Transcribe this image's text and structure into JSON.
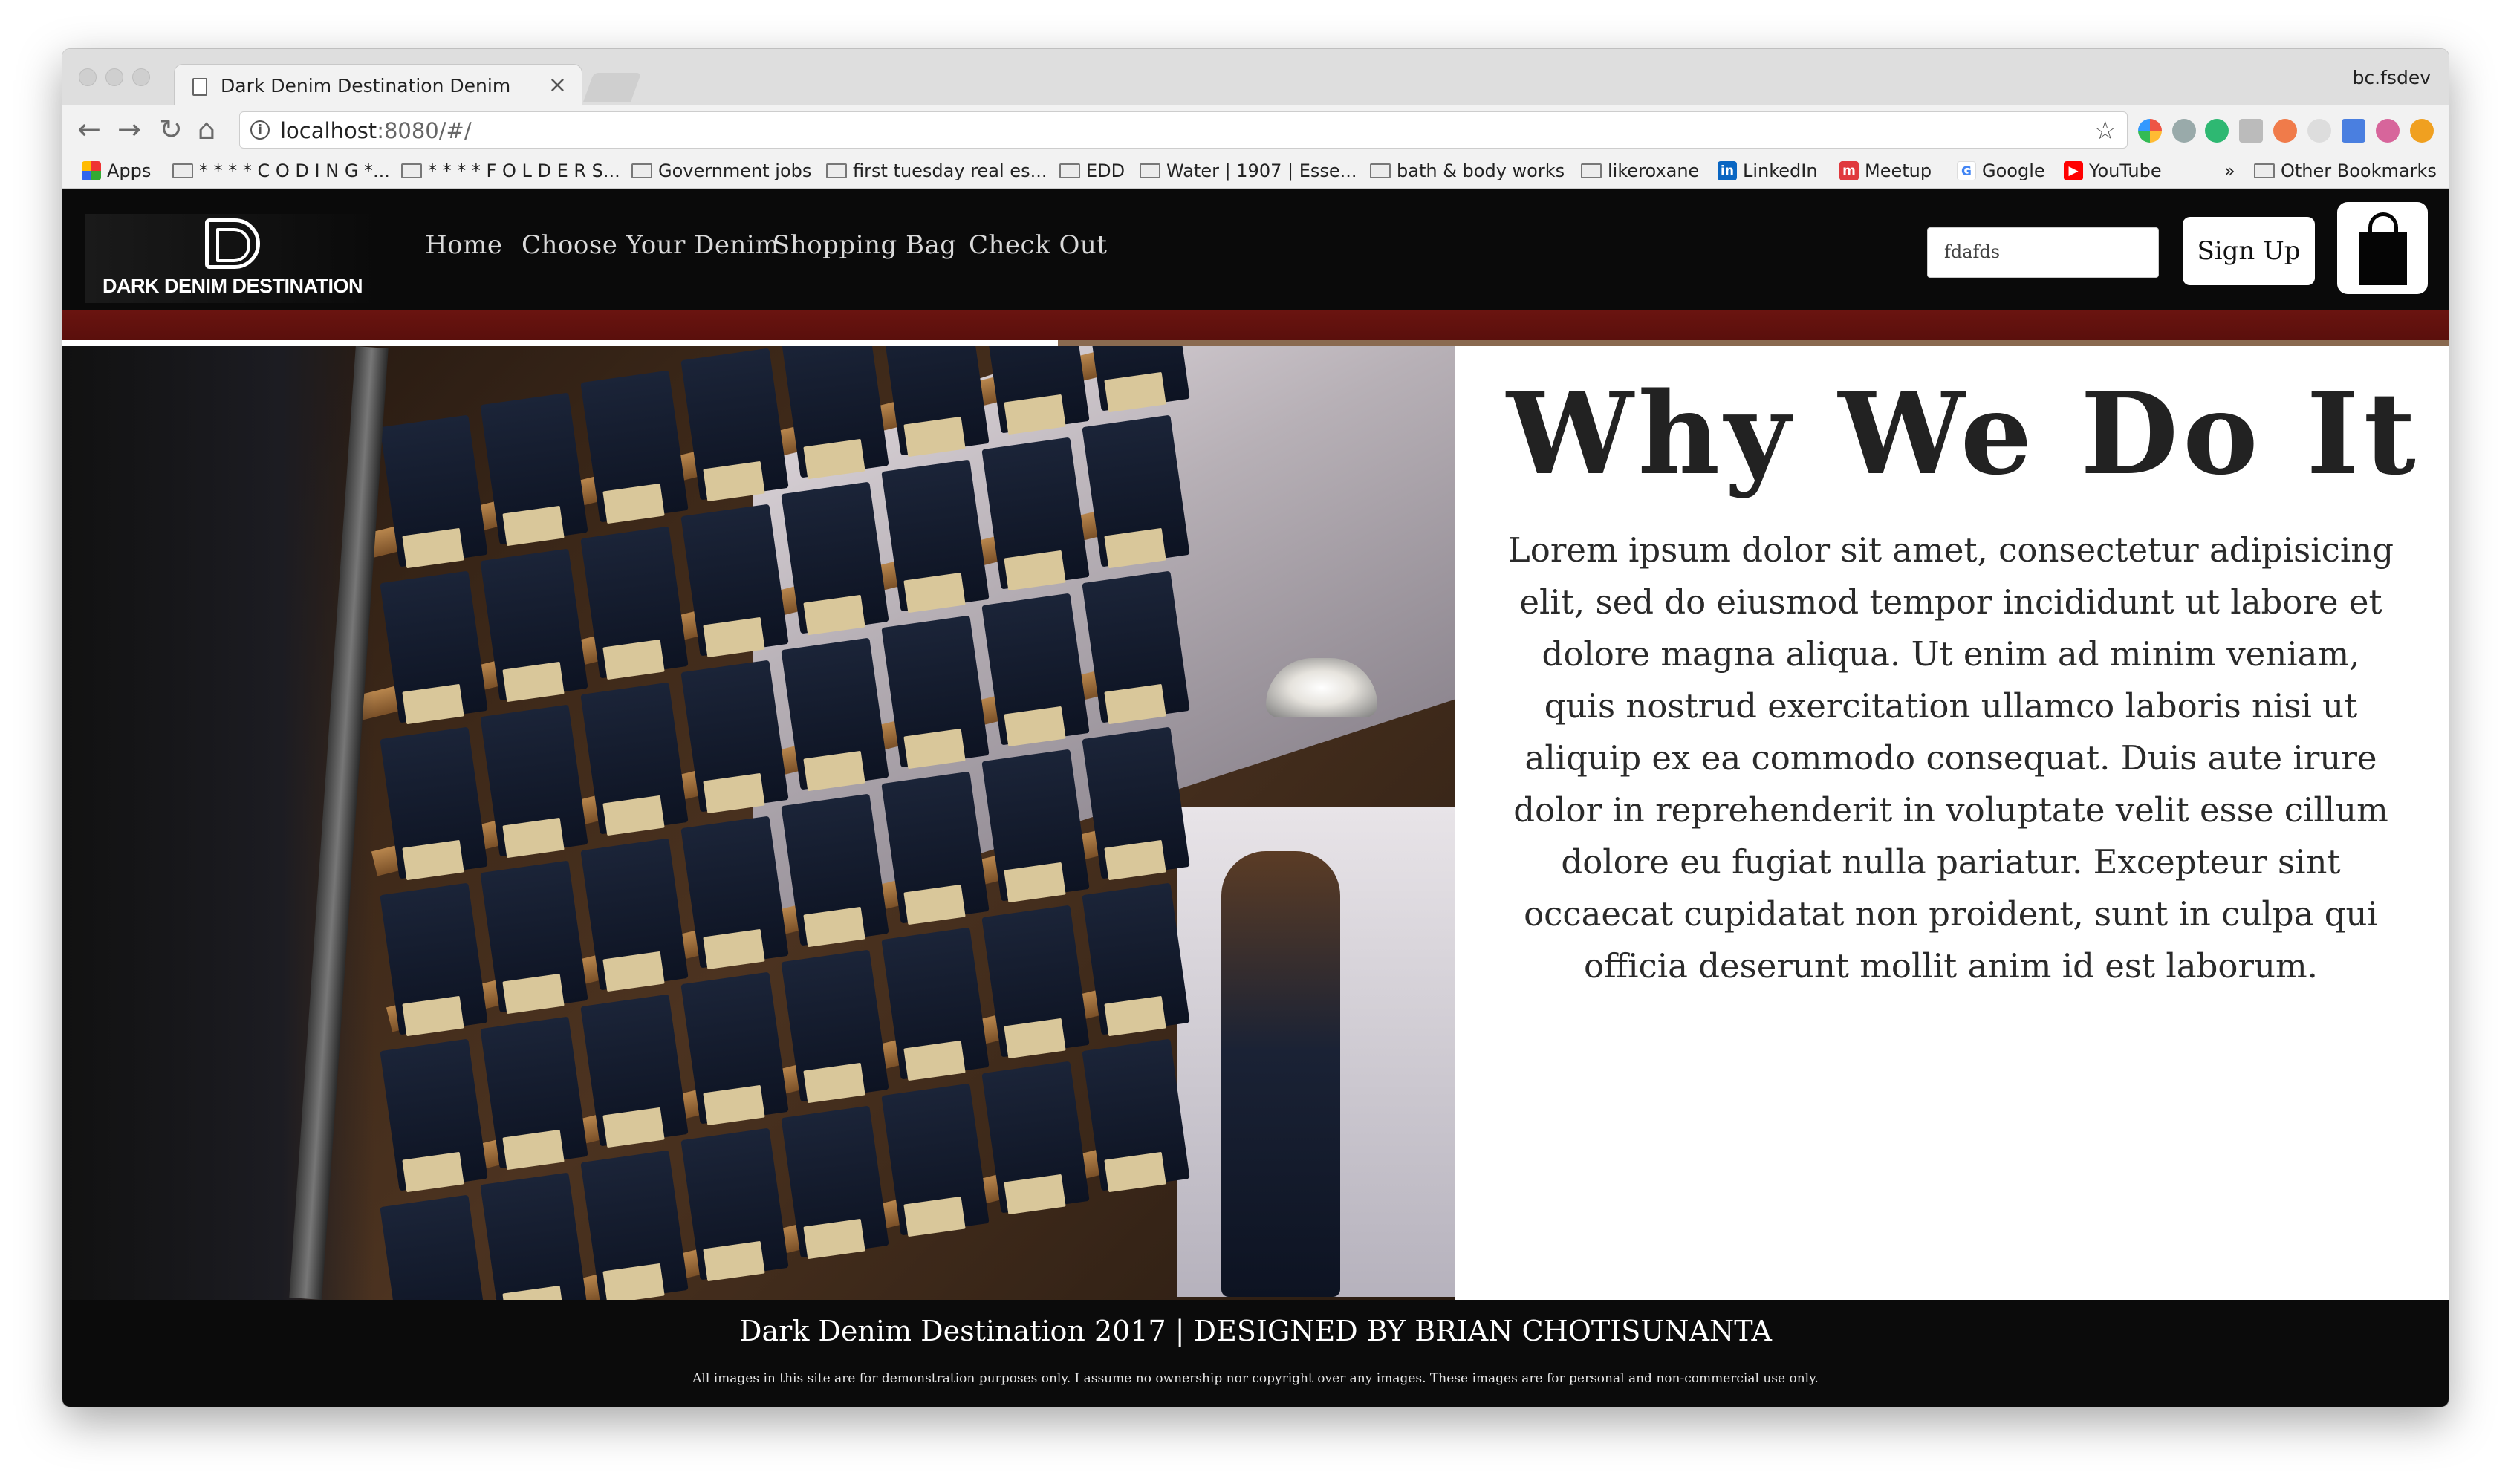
{
  "browser": {
    "tab_title": "Dark Denim Destination Denim",
    "profile_name": "bc.fsdev",
    "url_host": "localhost",
    "url_path": ":8080/#/"
  },
  "bookmarks": [
    {
      "label": "Apps",
      "icon": "apps-grid-icon"
    },
    {
      "label": "* * * * C O D I N G *...",
      "icon": "folder-icon"
    },
    {
      "label": "* * * * F O L D E R S...",
      "icon": "folder-icon"
    },
    {
      "label": "Government jobs",
      "icon": "folder-icon"
    },
    {
      "label": "first tuesday real es...",
      "icon": "folder-icon"
    },
    {
      "label": "EDD",
      "icon": "folder-icon"
    },
    {
      "label": "Water | 1907 | Esse...",
      "icon": "folder-icon"
    },
    {
      "label": "bath & body works",
      "icon": "folder-icon"
    },
    {
      "label": "likeroxane",
      "icon": "folder-icon"
    },
    {
      "label": "LinkedIn",
      "icon": "linkedin-icon"
    },
    {
      "label": "Meetup",
      "icon": "meetup-icon"
    },
    {
      "label": "Google",
      "icon": "google-icon"
    },
    {
      "label": "YouTube",
      "icon": "youtube-icon"
    },
    {
      "label": "»",
      "icon": "overflow-chevron"
    },
    {
      "label": "Other Bookmarks",
      "icon": "folder-icon"
    }
  ],
  "site": {
    "logo_text": "DARK DENIM DESTINATION",
    "nav": [
      "Home",
      "Choose Your Denim",
      "Shopping Bag",
      "Check Out"
    ],
    "search_value": "fdafds",
    "signup_label": "Sign Up"
  },
  "about": {
    "title": "Why We Do It",
    "body": "Lorem ipsum dolor sit amet, consectetur adipisicing elit, sed do eiusmod tempor incididunt ut labore et dolore magna aliqua. Ut enim ad minim veniam, quis nostrud exercitation ullamco laboris nisi ut aliquip ex ea commodo consequat. Duis aute irure dolor in reprehenderit in voluptate velit esse cillum dolore eu fugiat nulla pariatur. Excepteur sint occaecat cupidatat non proident, sunt in culpa qui officia deserunt mollit anim id est laborum."
  },
  "footer": {
    "main": "Dark Denim Destination 2017 | DESIGNED BY BRIAN CHOTISUNANTA",
    "note": "All images in this site are for demonstration purposes only. I assume no ownership nor copyright over any images. These images are for personal and non-commercial use only."
  },
  "colors": {
    "nav_bg": "#0a0a0a",
    "accent_bar": "#6a1410"
  }
}
